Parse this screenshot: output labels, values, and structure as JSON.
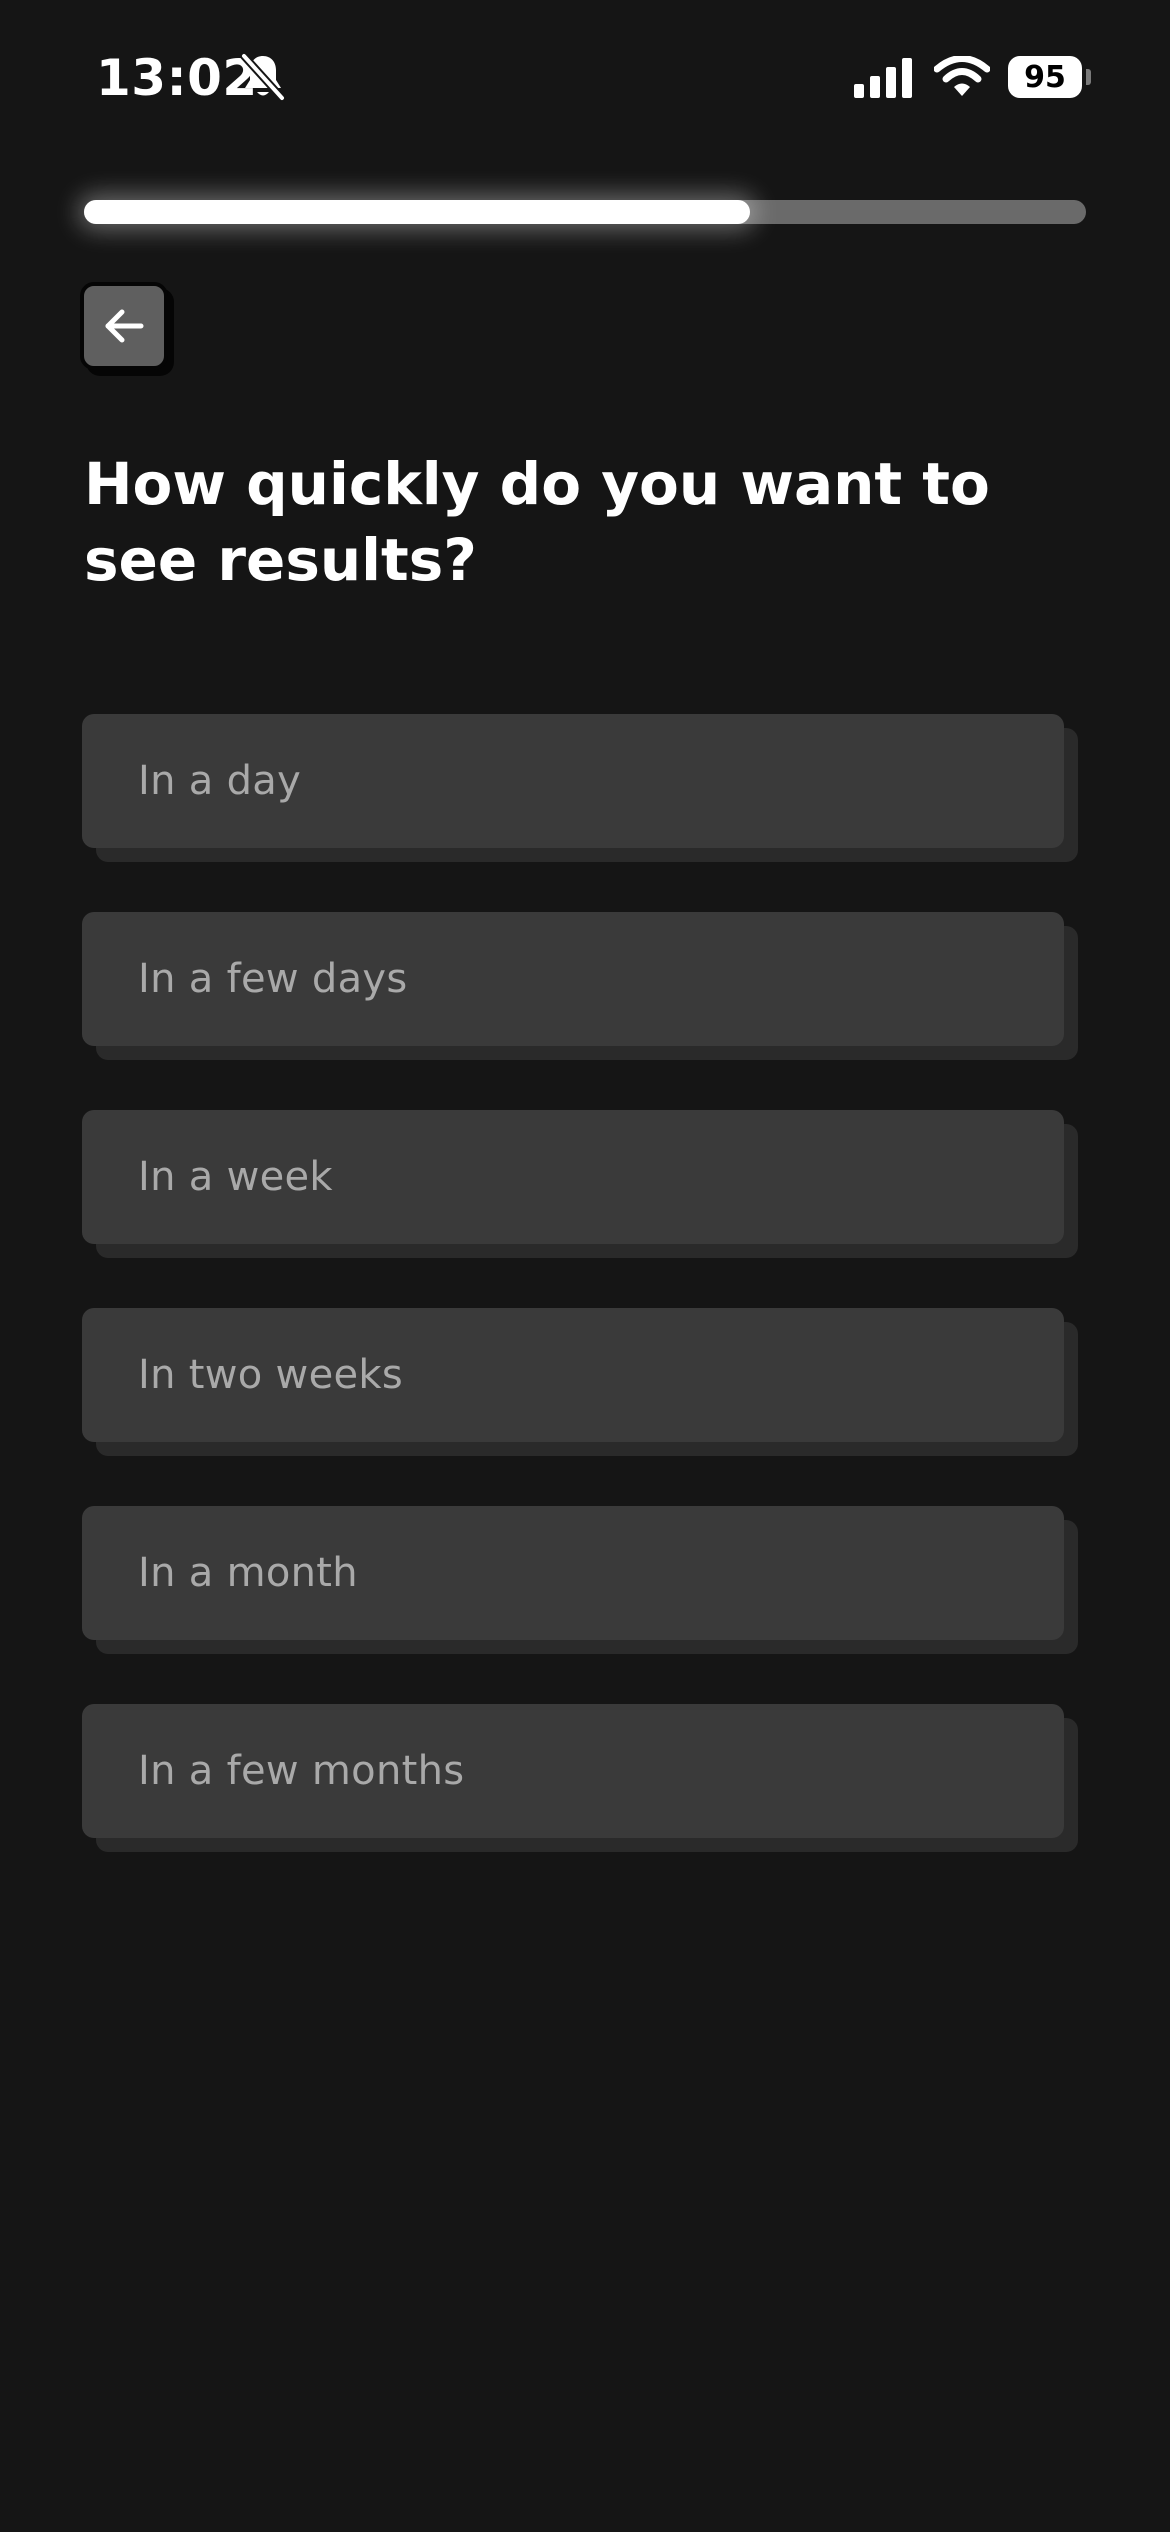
{
  "status_bar": {
    "time": "13:02",
    "battery_percent": "95",
    "icons": [
      "bell-slash-icon",
      "cellular-signal-icon",
      "wifi-icon",
      "battery-icon"
    ]
  },
  "progress": {
    "fraction": 0.665
  },
  "back_button": {
    "icon": "arrow-left-icon"
  },
  "question": {
    "text": "How quickly do you want to see results?"
  },
  "options": [
    {
      "label": "In a day"
    },
    {
      "label": "In a few days"
    },
    {
      "label": "In a week"
    },
    {
      "label": "In two weeks"
    },
    {
      "label": "In a month"
    },
    {
      "label": "In a few months"
    }
  ],
  "colors": {
    "background": "#151515",
    "option_background": "#3a3a3a",
    "option_text": "#a9a9a9",
    "progress_track": "#6a6a6a",
    "progress_fill": "#ffffff"
  }
}
